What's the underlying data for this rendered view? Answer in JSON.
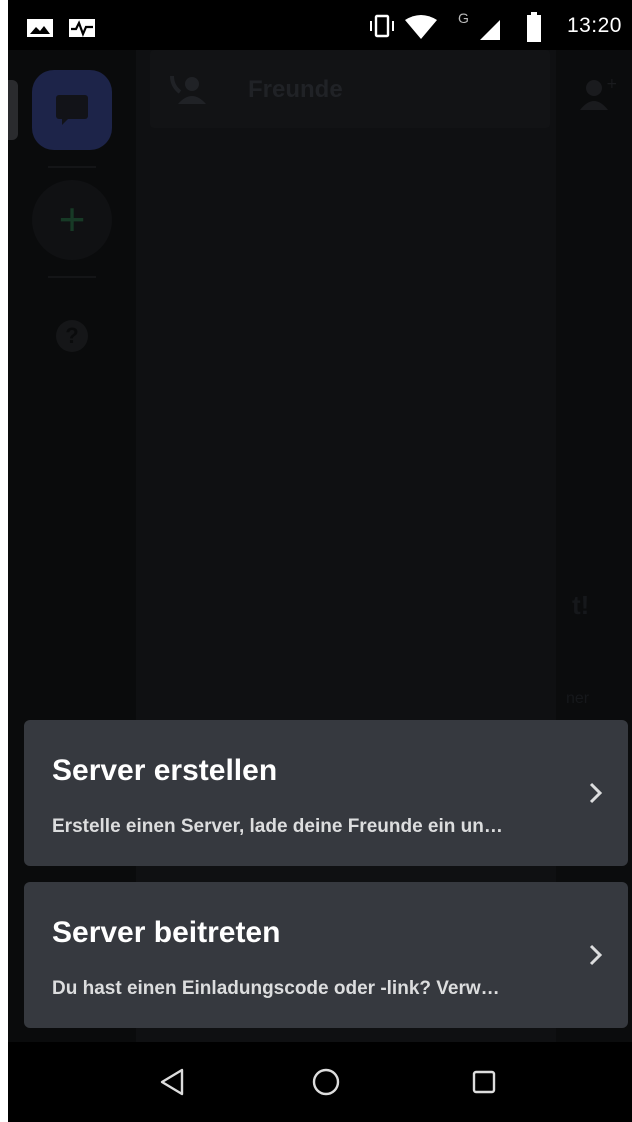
{
  "status_bar": {
    "time": "13:20",
    "network_label": "G",
    "icons": [
      "image-icon",
      "pulse-icon",
      "vibrate-icon",
      "wifi-icon",
      "cell-signal-icon",
      "battery-icon"
    ]
  },
  "app": {
    "header_title": "Freunde",
    "ghost_fragments": [
      "t!",
      "ner"
    ]
  },
  "bottom_sheet": {
    "create": {
      "title": "Server erstellen",
      "subtitle": "Erstelle einen Server, lade deine Freunde ein un…"
    },
    "join": {
      "title": "Server beitreten",
      "subtitle": "Du hast einen Einladungscode oder -link? Verw…"
    }
  },
  "colors": {
    "card_bg": "#36393f",
    "overlay_bg": "#0b0c0d",
    "text_primary": "#ffffff",
    "text_secondary": "#dcddde"
  }
}
